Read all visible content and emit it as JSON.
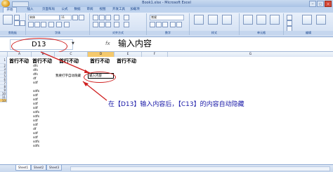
{
  "window": {
    "title": "Book1.xlsx - Microsoft Excel",
    "min": "−",
    "max": "□",
    "close": "×"
  },
  "ribbon": {
    "tabs": [
      "开始",
      "插入",
      "页面布局",
      "公式",
      "数据",
      "审阅",
      "视图",
      "开发工具",
      "加载项"
    ],
    "active_tab": "开始",
    "groups": [
      "剪贴板",
      "字体",
      "对齐方式",
      "数字",
      "样式",
      "单元格",
      "编辑"
    ],
    "font_name": "宋体",
    "font_size": "11",
    "number_format": "常规"
  },
  "formula_bar": {
    "name_box": "D13",
    "fx_label": "fx",
    "content": "输入内容"
  },
  "columns": [
    "A",
    "B",
    "C",
    "D",
    "E",
    "F",
    "G"
  ],
  "active_column": "D",
  "rows": [
    "1",
    "2",
    "3",
    "4",
    "5",
    "6",
    "7",
    "8",
    "9",
    "10",
    "11",
    "12",
    "13",
    "14",
    "15",
    "16",
    "17",
    "18",
    "19",
    "20",
    "21",
    "22",
    "23",
    "24",
    "25",
    "26",
    "27",
    "28",
    "29"
  ],
  "active_row": "13",
  "frozen_header": [
    "首行不动",
    "首行不动",
    "首行不动",
    "首行不动",
    "首行不动"
  ],
  "column_b_values": [
    "dfs",
    "dfs",
    "dfs",
    "df",
    "sdf",
    "",
    "",
    "sdfs",
    "sdf",
    "sdf",
    "sdf",
    "sdf",
    "sdfs",
    "sdfs",
    "sdf",
    "sdf",
    "df",
    "sdf",
    "sdf",
    "sdfs",
    "sdfs"
  ],
  "cell_c13": "我要打字自动隐藏",
  "cell_d13": "输入内容",
  "annotation": "在【D13】输入内容后，【C13】的内容自动隐藏",
  "sheet_tabs": [
    "Sheet1",
    "Sheet2",
    "Sheet3"
  ],
  "active_sheet": "Sheet1",
  "colors": {
    "annotation_text": "#1a1aa8",
    "highlight_ellipse": "#d02020",
    "active_header": "#f5c96c"
  }
}
